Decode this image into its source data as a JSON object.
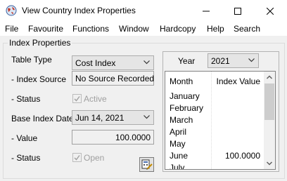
{
  "window": {
    "title": "View Country Index Properties",
    "minimize_glyph": "–",
    "maximize_glyph": "☐",
    "close_glyph": "✕"
  },
  "menu": [
    "File",
    "Favourite",
    "Functions",
    "Window",
    "Hardcopy",
    "Help",
    "Search"
  ],
  "group": {
    "title": "Index Properties",
    "table_type_label": "Table Type",
    "table_type_value": "Cost Index",
    "index_source_label": "- Index Source",
    "index_source_value": "No Source Recorded",
    "status_label_1": "- Status",
    "status_value_1": "Active",
    "status_checked_1": true,
    "base_index_date_label": "Base Index Date",
    "base_index_date_value": "Jun 14, 2021",
    "value_label": "- Value",
    "value_value": "100.0000",
    "status_label_2": "- Status",
    "status_value_2": "Open",
    "status_checked_2": true
  },
  "year": {
    "label": "Year",
    "value": "2021"
  },
  "grid": {
    "headers": {
      "month": "Month",
      "value": "Index Value"
    },
    "rows": [
      {
        "month": "January",
        "value": ""
      },
      {
        "month": "February",
        "value": ""
      },
      {
        "month": "March",
        "value": ""
      },
      {
        "month": "April",
        "value": ""
      },
      {
        "month": "May",
        "value": ""
      },
      {
        "month": "June",
        "value": "100.0000"
      },
      {
        "month": "July",
        "value": ""
      }
    ]
  },
  "icons": {
    "app": "globe-icon",
    "dropdown": "chevron-down-icon",
    "edit": "edit-calculator-icon",
    "scroll_up": "scroll-up-arrow-icon",
    "scroll_down": "scroll-down-arrow-icon"
  }
}
